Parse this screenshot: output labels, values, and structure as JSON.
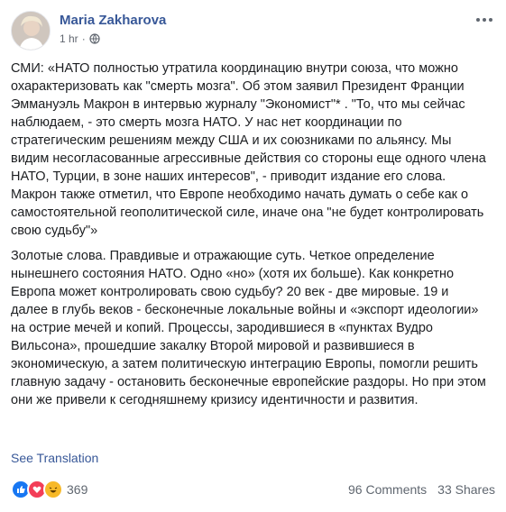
{
  "post": {
    "author": "Maria Zakharova",
    "time": "1 hr",
    "separator": "·",
    "paragraphs": [
      "СМИ: «НАТО полностью утратила координацию внутри союза, что можно охарактеризовать как \"смерть мозга\". Об этом заявил Президент Франции Эммануэль Макрон в интервью журналу \"Экономист\"* . \"То, что мы сейчас наблюдаем, - это смерть мозга НАТО. У нас нет координации по стратегическим решениям между США и их союзниками по альянсу. Мы видим несогласованные агрессивные действия со стороны еще одного члена НАТО, Турции, в зоне наших интересов\", - приводит издание его слова. Макрон также отметил, что Европе необходимо начать думать о себе как о самостоятельной геополитической силе, иначе она \"не будет контролировать свою судьбу\"»",
      "Золотые слова. Правдивые и отражающие суть. Четкое определение нынешнего состояния НАТО. Одно «но» (хотя их больше). Как конкретно Европа может контролировать свою судьбу? 20 век - две мировые. 19 и далее в глубь веков - бесконечные локальные войны и «экспорт идеологии» на острие мечей и копий. Процессы, зародившиеся в «пунктах Вудро Вильсона», прошедшие закалку Второй мировой и развившиеся в экономическую, а затем политическую интеграцию Европы, помогли решить главную задачу - остановить бесконечные европейские раздоры. Но при этом они же привели к сегодняшнему кризису идентичности и развития."
    ],
    "see_translation": "See Translation",
    "reactions_count": "369",
    "comments": "96 Comments",
    "shares": "33 Shares"
  },
  "colors": {
    "link": "#385898",
    "text": "#1c1e21",
    "muted": "#606770",
    "like": "#1877f2",
    "love": "#f33e58",
    "haha": "#f7b928"
  },
  "icons": [
    "globe-icon",
    "more-options-icon",
    "like-reaction-icon",
    "love-reaction-icon",
    "haha-reaction-icon"
  ]
}
